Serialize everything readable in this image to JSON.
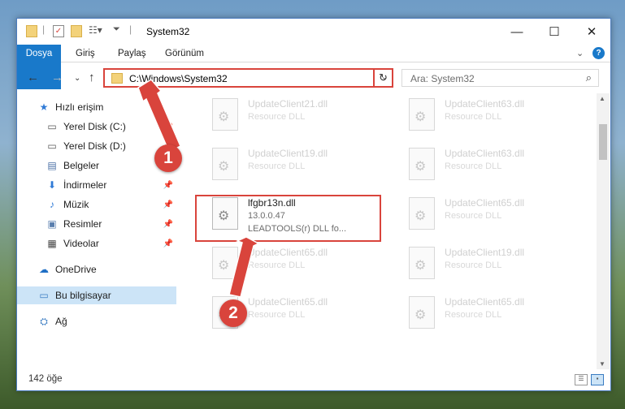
{
  "window": {
    "title": "System32",
    "controls": {
      "minimize": "—",
      "maximize": "☐",
      "close": "✕"
    }
  },
  "ribbon": {
    "tabs": [
      {
        "label": "Dosya"
      },
      {
        "label": "Giriş"
      },
      {
        "label": "Paylaş"
      },
      {
        "label": "Görünüm"
      }
    ],
    "help_icon": "?"
  },
  "address": {
    "path": "C:\\Windows\\System32",
    "search_placeholder": "Ara: System32"
  },
  "navpane": {
    "items": [
      {
        "label": "Hızlı erişim",
        "icon": "star-icon",
        "glyph": "★",
        "color": "#2f7ad6",
        "pinned": false
      },
      {
        "label": "Yerel Disk (C:)",
        "icon": "drive-icon",
        "glyph": "▭",
        "color": "#555555",
        "pinned": true
      },
      {
        "label": "Yerel Disk (D:)",
        "icon": "drive-icon",
        "glyph": "▭",
        "color": "#555555",
        "pinned": true
      },
      {
        "label": "Belgeler",
        "icon": "document-icon",
        "glyph": "▤",
        "color": "#4a6fa5",
        "pinned": true
      },
      {
        "label": "İndirmeler",
        "icon": "download-icon",
        "glyph": "⬇",
        "color": "#2f7ad6",
        "pinned": true
      },
      {
        "label": "Müzik",
        "icon": "music-icon",
        "glyph": "♪",
        "color": "#2f7ad6",
        "pinned": true
      },
      {
        "label": "Resimler",
        "icon": "picture-icon",
        "glyph": "▣",
        "color": "#5a7fae",
        "pinned": true
      },
      {
        "label": "Videolar",
        "icon": "video-icon",
        "glyph": "▦",
        "color": "#444444",
        "pinned": true
      },
      {
        "label": "OneDrive",
        "icon": "cloud-icon",
        "glyph": "☁",
        "color": "#1f6fc5",
        "pinned": false
      },
      {
        "label": "Bu bilgisayar",
        "icon": "computer-icon",
        "glyph": "▭",
        "color": "#3a7cc2",
        "pinned": false
      },
      {
        "label": "Ağ",
        "icon": "network-icon",
        "glyph": "⛭",
        "color": "#3a7cc2",
        "pinned": false
      }
    ]
  },
  "files": [
    {
      "name": "UpdateClient21.dll",
      "desc": "Resource DLL"
    },
    {
      "name": "UpdateClient63.dll",
      "desc": "Resource DLL"
    },
    {
      "name": "UpdateClient19.dll",
      "desc": "Resource DLL"
    },
    {
      "name": "UpdateClient63.dll",
      "desc": "Resource DLL"
    },
    {
      "name": "lfgbr13n.dll",
      "version": "13.0.0.47",
      "desc": "LEADTOOLS(r) DLL fo..."
    },
    {
      "name": "UpdateClient65.dll",
      "desc": "Resource DLL"
    },
    {
      "name": "UpdateClient65.dll",
      "desc": "Resource DLL"
    },
    {
      "name": "UpdateClient19.dll",
      "desc": "Resource DLL"
    },
    {
      "name": "UpdateClient65.dll",
      "desc": "Resource DLL"
    },
    {
      "name": "UpdateClient65.dll",
      "desc": "Resource DLL"
    }
  ],
  "status": {
    "item_count": "142 öğe"
  },
  "annotations": {
    "step1": "1",
    "step2": "2",
    "color": "#d9443c"
  }
}
